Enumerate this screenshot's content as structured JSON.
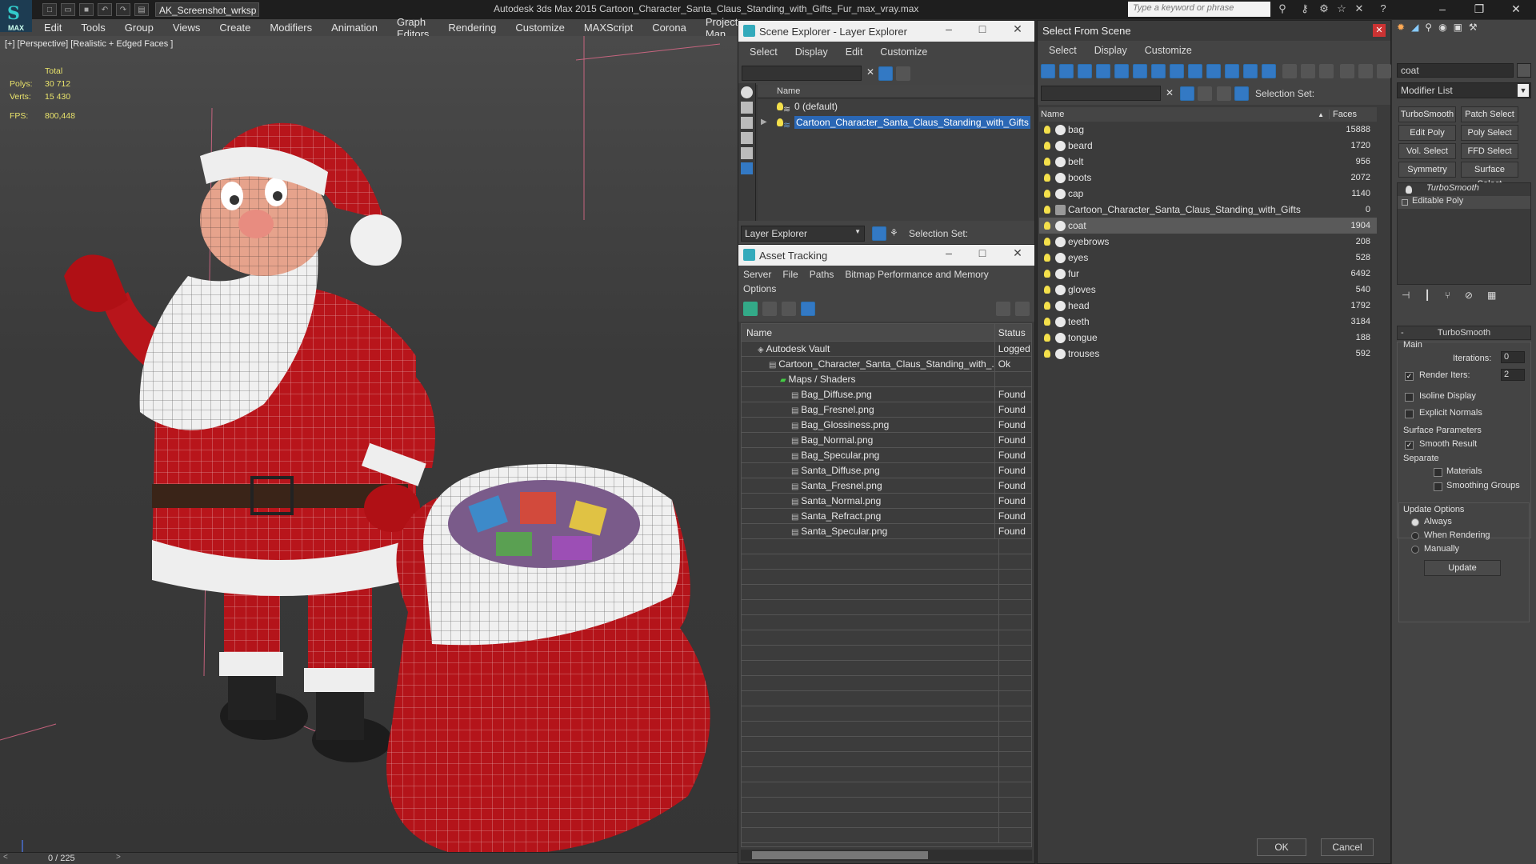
{
  "title_bar": {
    "logo_label": "MAX",
    "workspace": "AK_Screenshot_wrksp",
    "app_title": "Autodesk 3ds Max  2015    Cartoon_Character_Santa_Claus_Standing_with_Gifts_Fur_max_vray.max",
    "search_placeholder": "Type a keyword or phrase"
  },
  "menubar": [
    "Edit",
    "Tools",
    "Group",
    "Views",
    "Create",
    "Modifiers",
    "Animation",
    "Graph Editors",
    "Rendering",
    "Customize",
    "MAXScript",
    "Corona",
    "Project Man"
  ],
  "viewport": {
    "label": "[+] [Perspective] [Realistic + Edged Faces ]",
    "stats": {
      "total_label": "Total",
      "polys_label": "Polys:",
      "polys": "30 712",
      "verts_label": "Verts:",
      "verts": "15 430",
      "fps_label": "FPS:",
      "fps": "800,448"
    }
  },
  "timeline": {
    "frame": "0 / 225"
  },
  "scene_explorer": {
    "title": "Scene Explorer - Layer Explorer",
    "menu": [
      "Select",
      "Display",
      "Edit",
      "Customize"
    ],
    "column": "Name",
    "rows": [
      "0 (default)",
      "Cartoon_Character_Santa_Claus_Standing_with_Gifts"
    ],
    "bottom_label": "Layer Explorer",
    "selection_set": "Selection Set:"
  },
  "asset_tracking": {
    "title": "Asset Tracking",
    "menu1": [
      "Server",
      "File",
      "Paths",
      "Bitmap Performance and Memory"
    ],
    "menu2": [
      "Options"
    ],
    "col_name": "Name",
    "col_status": "Status",
    "rows": [
      {
        "name": "Autodesk Vault",
        "status": "Logged",
        "indent": 1
      },
      {
        "name": "Cartoon_Character_Santa_Claus_Standing_with_...",
        "status": "Ok",
        "indent": 2
      },
      {
        "name": "Maps / Shaders",
        "status": "",
        "indent": 3
      },
      {
        "name": "Bag_Diffuse.png",
        "status": "Found",
        "indent": 4
      },
      {
        "name": "Bag_Fresnel.png",
        "status": "Found",
        "indent": 4
      },
      {
        "name": "Bag_Glossiness.png",
        "status": "Found",
        "indent": 4
      },
      {
        "name": "Bag_Normal.png",
        "status": "Found",
        "indent": 4
      },
      {
        "name": "Bag_Specular.png",
        "status": "Found",
        "indent": 4
      },
      {
        "name": "Santa_Diffuse.png",
        "status": "Found",
        "indent": 4
      },
      {
        "name": "Santa_Fresnel.png",
        "status": "Found",
        "indent": 4
      },
      {
        "name": "Santa_Normal.png",
        "status": "Found",
        "indent": 4
      },
      {
        "name": "Santa_Refract.png",
        "status": "Found",
        "indent": 4
      },
      {
        "name": "Santa_Specular.png",
        "status": "Found",
        "indent": 4
      }
    ]
  },
  "select_from_scene": {
    "title": "Select From Scene",
    "menu": [
      "Select",
      "Display",
      "Customize"
    ],
    "selection_set": "Selection Set:",
    "col_name": "Name",
    "col_faces": "Faces",
    "rows": [
      {
        "name": "bag",
        "faces": "15888"
      },
      {
        "name": "beard",
        "faces": "1720"
      },
      {
        "name": "belt",
        "faces": "956"
      },
      {
        "name": "boots",
        "faces": "2072"
      },
      {
        "name": "cap",
        "faces": "1140"
      },
      {
        "name": "Cartoon_Character_Santa_Claus_Standing_with_Gifts",
        "faces": "0"
      },
      {
        "name": "coat",
        "faces": "1904"
      },
      {
        "name": "eyebrows",
        "faces": "208"
      },
      {
        "name": "eyes",
        "faces": "528"
      },
      {
        "name": "fur",
        "faces": "6492"
      },
      {
        "name": "gloves",
        "faces": "540"
      },
      {
        "name": "head",
        "faces": "1792"
      },
      {
        "name": "teeth",
        "faces": "3184"
      },
      {
        "name": "tongue",
        "faces": "188"
      },
      {
        "name": "trouses",
        "faces": "592"
      }
    ],
    "ok": "OK",
    "cancel": "Cancel"
  },
  "command_panel": {
    "object_name": "coat",
    "modifier_list": "Modifier List",
    "buttons": [
      "TurboSmooth",
      "Patch Select",
      "Edit Poly",
      "Poly Select",
      "Vol. Select",
      "FFD Select",
      "Symmetry",
      "Surface Select"
    ],
    "stack": [
      "TurboSmooth",
      "Editable Poly"
    ],
    "rollout_title": "TurboSmooth",
    "main": "Main",
    "iterations_label": "Iterations:",
    "iterations": "0",
    "render_iters_label": "Render Iters:",
    "render_iters": "2",
    "isoline": "Isoline Display",
    "explicit": "Explicit Normals",
    "surface_params": "Surface Parameters",
    "smooth_result": "Smooth Result",
    "separate": "Separate",
    "materials": "Materials",
    "smoothing_groups": "Smoothing Groups",
    "update_options": "Update Options",
    "always": "Always",
    "when_rendering": "When Rendering",
    "manually": "Manually",
    "update": "Update"
  }
}
